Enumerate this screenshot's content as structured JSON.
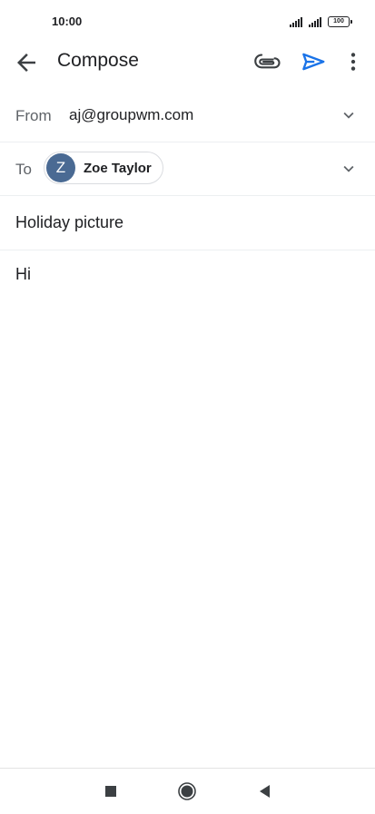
{
  "status_bar": {
    "time": "10:00",
    "battery": "100"
  },
  "app_bar": {
    "title": "Compose",
    "icons": [
      "arrow-back-icon",
      "paperclip-icon",
      "send-icon",
      "more-vert-icon"
    ],
    "send_color": "#1a73e8"
  },
  "from": {
    "label": "From",
    "value": "aj@groupwm.com"
  },
  "to": {
    "label": "To",
    "recipient": {
      "initial": "Z",
      "name": "Zoe Taylor",
      "avatar_color": "#4a6a93"
    }
  },
  "subject": {
    "value": "Holiday picture"
  },
  "body": {
    "value": "Hi"
  },
  "nav_bar": {
    "icons": [
      "recents-square-icon",
      "home-circle-icon",
      "back-triangle-icon"
    ]
  }
}
